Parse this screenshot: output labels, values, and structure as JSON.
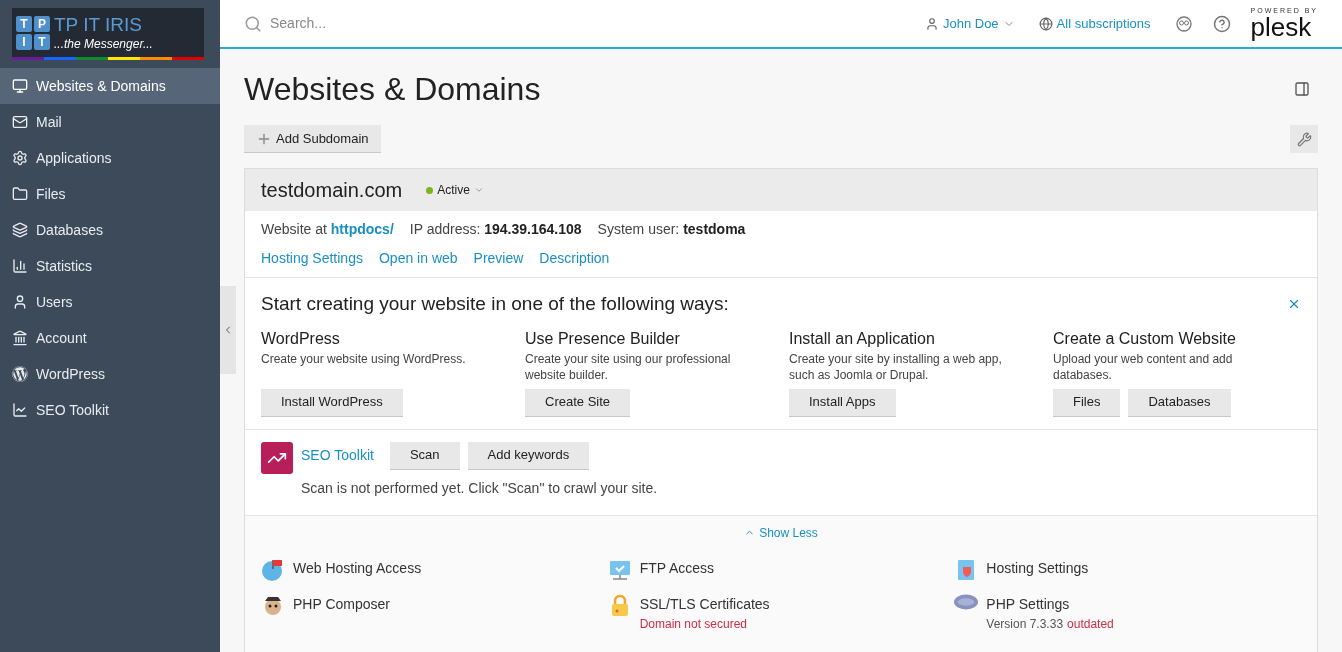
{
  "logo": {
    "tiles": [
      "T",
      "P",
      "I",
      "T"
    ],
    "title": "TP IT IRIS",
    "tagline": "...the Messenger..."
  },
  "sidebar": {
    "items": [
      {
        "label": "Websites & Domains",
        "selected": true
      },
      {
        "label": "Mail",
        "selected": false
      },
      {
        "label": "Applications",
        "selected": false
      },
      {
        "label": "Files",
        "selected": false
      },
      {
        "label": "Databases",
        "selected": false
      },
      {
        "label": "Statistics",
        "selected": false
      },
      {
        "label": "Users",
        "selected": false
      },
      {
        "label": "Account",
        "selected": false
      },
      {
        "label": "WordPress",
        "selected": false
      },
      {
        "label": "SEO Toolkit",
        "selected": false
      }
    ]
  },
  "header": {
    "search": {
      "placeholder": "Search..."
    },
    "user": "John Doe",
    "subscriptions": "All subscriptions",
    "powered_by": "POWERED BY",
    "brand": "plesk"
  },
  "page": {
    "title": "Websites & Domains",
    "add_button": "Add Subdomain"
  },
  "domain": {
    "name": "testdomain.com",
    "status": {
      "label": "Active",
      "color": "#7cb518"
    },
    "info": [
      {
        "label": "Website at",
        "value": "httpdocs/",
        "kind": "link"
      },
      {
        "label": "IP address:",
        "value": "194.39.164.108",
        "kind": "bold"
      },
      {
        "label": "System user:",
        "value": "testdoma",
        "kind": "bold"
      }
    ],
    "links": [
      "Hosting Settings",
      "Open in web",
      "Preview",
      "Description"
    ],
    "start": {
      "title": "Start creating your website in one of the following ways:",
      "options": [
        {
          "title": "WordPress",
          "text": "Create your website using WordPress.",
          "buttons": [
            "Install WordPress"
          ]
        },
        {
          "title": "Use Presence Builder",
          "text": "Create your site using our professional website builder.",
          "buttons": [
            "Create Site"
          ]
        },
        {
          "title": "Install an Application",
          "text": "Create your site by installing a web app, such as Joomla or Drupal.",
          "buttons": [
            "Install Apps"
          ]
        },
        {
          "title": "Create a Custom Website",
          "text": "Upload your web content and add databases.",
          "buttons": [
            "Files",
            "Databases"
          ]
        }
      ]
    },
    "seo": {
      "title": "SEO Toolkit",
      "buttons": [
        "Scan",
        "Add keywords"
      ],
      "message": "Scan is not performed yet. Click \"Scan\" to crawl your site."
    },
    "show_less": "Show Less",
    "tools": [
      {
        "title": "Web Hosting Access"
      },
      {
        "title": "FTP Access"
      },
      {
        "title": "Hosting Settings"
      },
      {
        "title": "PHP Composer"
      },
      {
        "title": "SSL/TLS Certificates",
        "notes": [
          {
            "text": "Domain not secured",
            "kind": "warning"
          }
        ]
      },
      {
        "title": "PHP Settings",
        "notes": [
          {
            "text": "Version 7.3.33",
            "kind": "plain"
          },
          {
            "text": "outdated",
            "kind": "warning"
          }
        ]
      }
    ]
  }
}
